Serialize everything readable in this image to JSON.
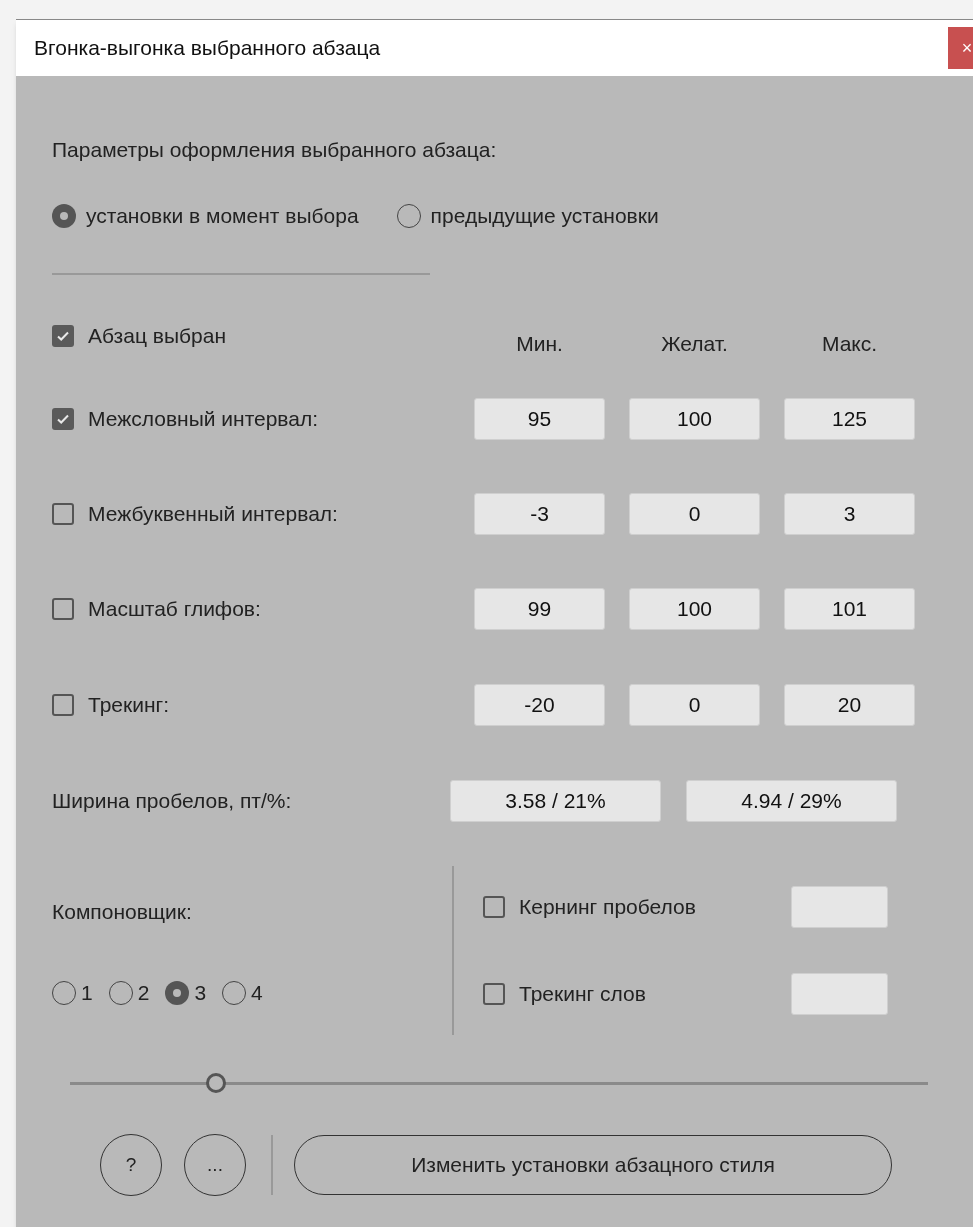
{
  "window": {
    "title": "Вгонка-выгонка выбранного абзаца",
    "close": "×"
  },
  "heading": "Параметры оформления выбранного абзаца:",
  "mode_options": [
    {
      "label": "установки в момент выбора",
      "selected": true
    },
    {
      "label": "предыдущие установки",
      "selected": false
    }
  ],
  "paragraph_selected": {
    "label": "Абзац выбран",
    "checked": true
  },
  "columns": [
    "Мин.",
    "Желат.",
    "Макс."
  ],
  "rows": [
    {
      "label": "Межсловный интервал:",
      "checked": true,
      "values": [
        "95",
        "100",
        "125"
      ]
    },
    {
      "label": "Межбуквенный интервал:",
      "checked": false,
      "values": [
        "-3",
        "0",
        "3"
      ]
    },
    {
      "label": "Масштаб глифов:",
      "checked": false,
      "values": [
        "99",
        "100",
        "101"
      ]
    },
    {
      "label": "Трекинг:",
      "checked": false,
      "values": [
        "-20",
        "0",
        "20"
      ]
    }
  ],
  "space_width": {
    "label": "Ширина пробелов, пт/%:",
    "values": [
      "3.58 / 21%",
      "4.94 / 29%"
    ]
  },
  "composer": {
    "label": "Компоновщик:",
    "options": [
      {
        "label": "1",
        "selected": false
      },
      {
        "label": "2",
        "selected": false
      },
      {
        "label": "3",
        "selected": true
      },
      {
        "label": "4",
        "selected": false
      }
    ]
  },
  "options": [
    {
      "label": "Кернинг пробелов",
      "checked": false
    },
    {
      "label": "Трекинг слов",
      "checked": false
    }
  ],
  "slider": {
    "level": 0.17
  },
  "buttons": {
    "help": "?",
    "more": "...",
    "apply": "Изменить установки абзацного стиля"
  }
}
